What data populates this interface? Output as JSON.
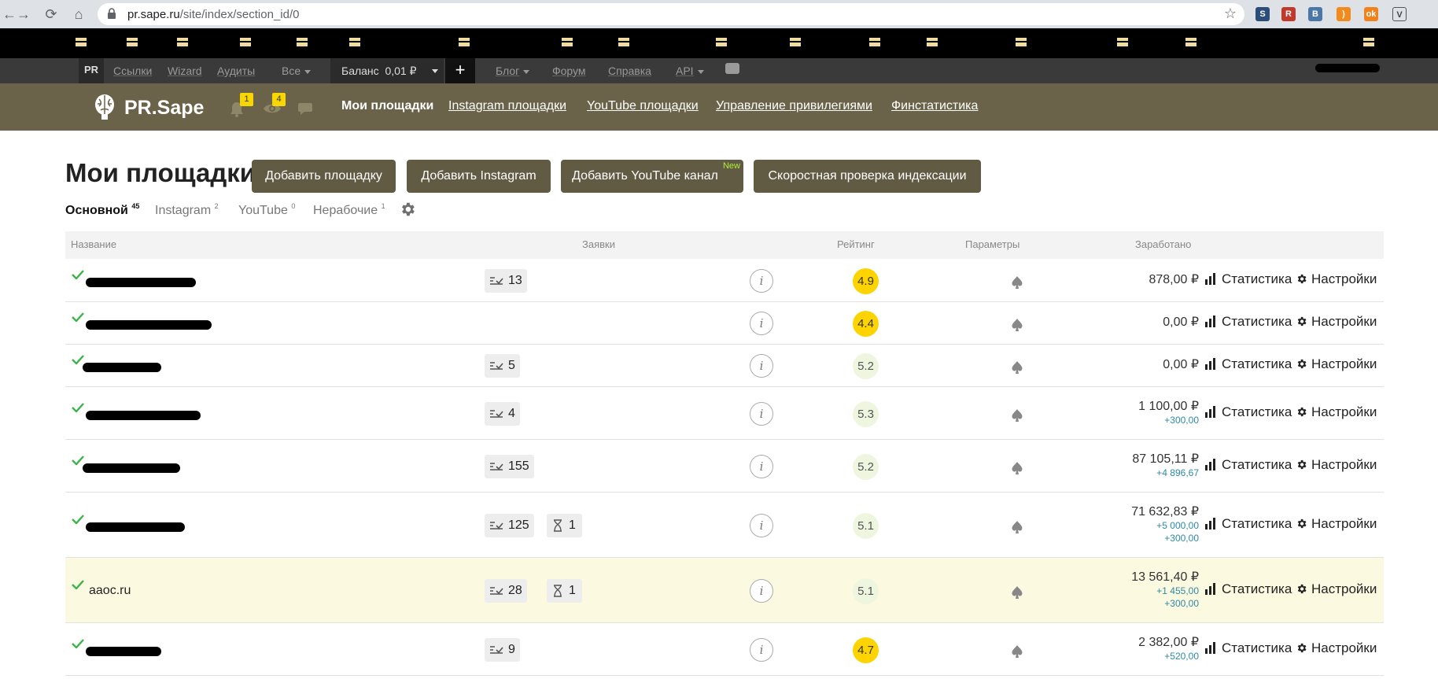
{
  "browser": {
    "url_host": "pr.sape.ru",
    "url_path": "/site/index/section_id/0"
  },
  "topstrip": {
    "pr": "PR",
    "links": "Ссылки",
    "wizard": "Wizard",
    "audits": "Аудиты",
    "all": "Все",
    "balance": "Баланс  0,01 ₽",
    "plus": "+",
    "blog": "Блог",
    "forum": "Форум",
    "help": "Справка",
    "api": "API"
  },
  "header": {
    "logo": "PR.Sape",
    "notif_badge": "1",
    "watch_badge": "4",
    "nav": [
      "Мои площадки",
      "Instagram площадки",
      "YouTube площадки",
      "Управление привилегиями",
      "Финстатистика"
    ]
  },
  "page": {
    "title": "Мои площадки",
    "buttons": {
      "add_site": "Добавить площадку",
      "add_instagram": "Добавить Instagram",
      "add_youtube": "Добавить YouTube канал",
      "new_label": "New",
      "index_check": "Скоростная проверка индексации"
    },
    "sections": [
      {
        "label": "Основной",
        "count": "45"
      },
      {
        "label": "Instagram",
        "count": "2"
      },
      {
        "label": "YouTube",
        "count": "0"
      },
      {
        "label": "Нерабочие",
        "count": "1"
      }
    ]
  },
  "table": {
    "headers": {
      "name": "Название",
      "requests": "Заявки",
      "rating": "Рейтинг",
      "params": "Параметры",
      "earned": "Заработано"
    },
    "stat_label": "Статистика",
    "settings_label": "Настройки",
    "info_label": "i",
    "rows": [
      {
        "name": "",
        "requests": "13",
        "pending": "",
        "rating": "4.9",
        "earned": "878,00 ₽",
        "plus": []
      },
      {
        "name": "",
        "requests": "",
        "pending": "",
        "rating": "4.4",
        "earned": "0,00 ₽",
        "plus": []
      },
      {
        "name": "",
        "requests": "5",
        "pending": "",
        "rating": "5.2",
        "earned": "0,00 ₽",
        "plus": []
      },
      {
        "name": "",
        "requests": "4",
        "pending": "",
        "rating": "5.3",
        "earned": "1 100,00 ₽",
        "plus": [
          "+300,00"
        ]
      },
      {
        "name": "",
        "requests": "155",
        "pending": "",
        "rating": "5.2",
        "earned": "87 105,11 ₽",
        "plus": [
          "+4 896,67"
        ]
      },
      {
        "name": "",
        "requests": "125",
        "pending": "1",
        "rating": "5.1",
        "earned": "71 632,83 ₽",
        "plus": [
          "+5 000,00",
          "+300,00"
        ]
      },
      {
        "name": "aaoc.ru",
        "requests": "28",
        "pending": "1",
        "rating": "5.1",
        "earned": "13 561,40 ₽",
        "plus": [
          "+1 455,00",
          "+300,00"
        ]
      },
      {
        "name": "",
        "requests": "9",
        "pending": "",
        "rating": "4.7",
        "earned": "2 382,00 ₽",
        "plus": [
          "+520,00"
        ]
      }
    ]
  }
}
